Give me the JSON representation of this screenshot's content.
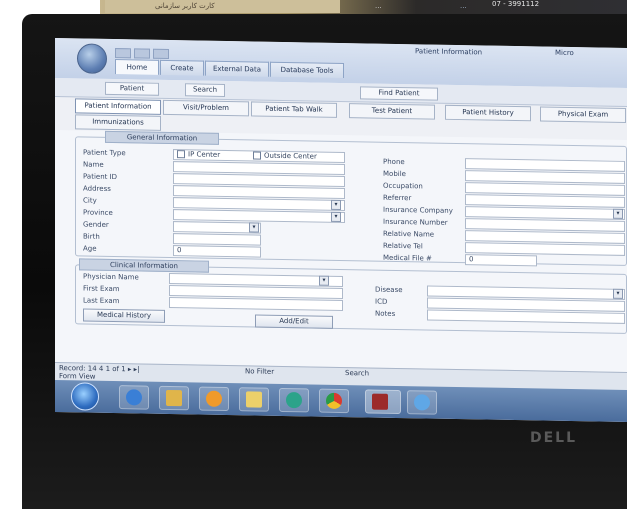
{
  "photo_top": {
    "sticker_text": "کارت کاربر سازمانی",
    "clock_date": "07 - 3991112",
    "clock_sub": "...",
    "extra": "..."
  },
  "window": {
    "title": "Patient Information",
    "controls": "Micro"
  },
  "ribbon_tabs": [
    {
      "label": "Home"
    },
    {
      "label": "Create"
    },
    {
      "label": "External Data"
    },
    {
      "label": "Database Tools"
    }
  ],
  "subbar": {
    "pill1": "Patient",
    "pill2": "Search",
    "doc_tab": "Find Patient"
  },
  "form_tabs": [
    {
      "label": "Patient Information"
    },
    {
      "label": "Visit/Problem"
    },
    {
      "label": "Patient Tab Walk"
    },
    {
      "label": "Test Patient"
    },
    {
      "label": "Patient History"
    },
    {
      "label": "Physical Exam"
    },
    {
      "label": "Immunizations"
    }
  ],
  "general": {
    "header": "General Information",
    "patient_type_label": "Patient Type",
    "options": {
      "option1": "IP Center",
      "option2": "Outside Center"
    },
    "labels": {
      "name": "Name",
      "patient_id": "Patient ID",
      "address": "Address",
      "city": "City",
      "province": "Province",
      "gender": "Gender",
      "birth": "Birth",
      "age": "Age"
    },
    "age_value": "0",
    "right_labels": {
      "phone": "Phone",
      "mobile": "Mobile",
      "occupation": "Occupation",
      "referrer": "Referrer",
      "insurance_company": "Insurance Company",
      "insurance_number": "Insurance Number",
      "relative_name": "Relative Name",
      "relative_tel": "Relative Tel",
      "medical_file_no": "Medical File #"
    },
    "medical_file_value": "0"
  },
  "clinical": {
    "header": "Clinical Information",
    "labels": {
      "physician_name": "Physician Name",
      "first_exam": "First Exam",
      "last_exam": "Last Exam"
    },
    "right_labels": {
      "disease": "Disease",
      "icd": "ICD",
      "notes": "Notes"
    },
    "buttons": {
      "medical_history": "Medical History",
      "add_edit": "Add/Edit"
    }
  },
  "statusbar": {
    "record": "Record: 14 4 1 of 1 ▸ ▸|",
    "filter": "No Filter",
    "search": "Search",
    "view": "Form View"
  },
  "brand": {
    "logo_text": "DELL"
  }
}
